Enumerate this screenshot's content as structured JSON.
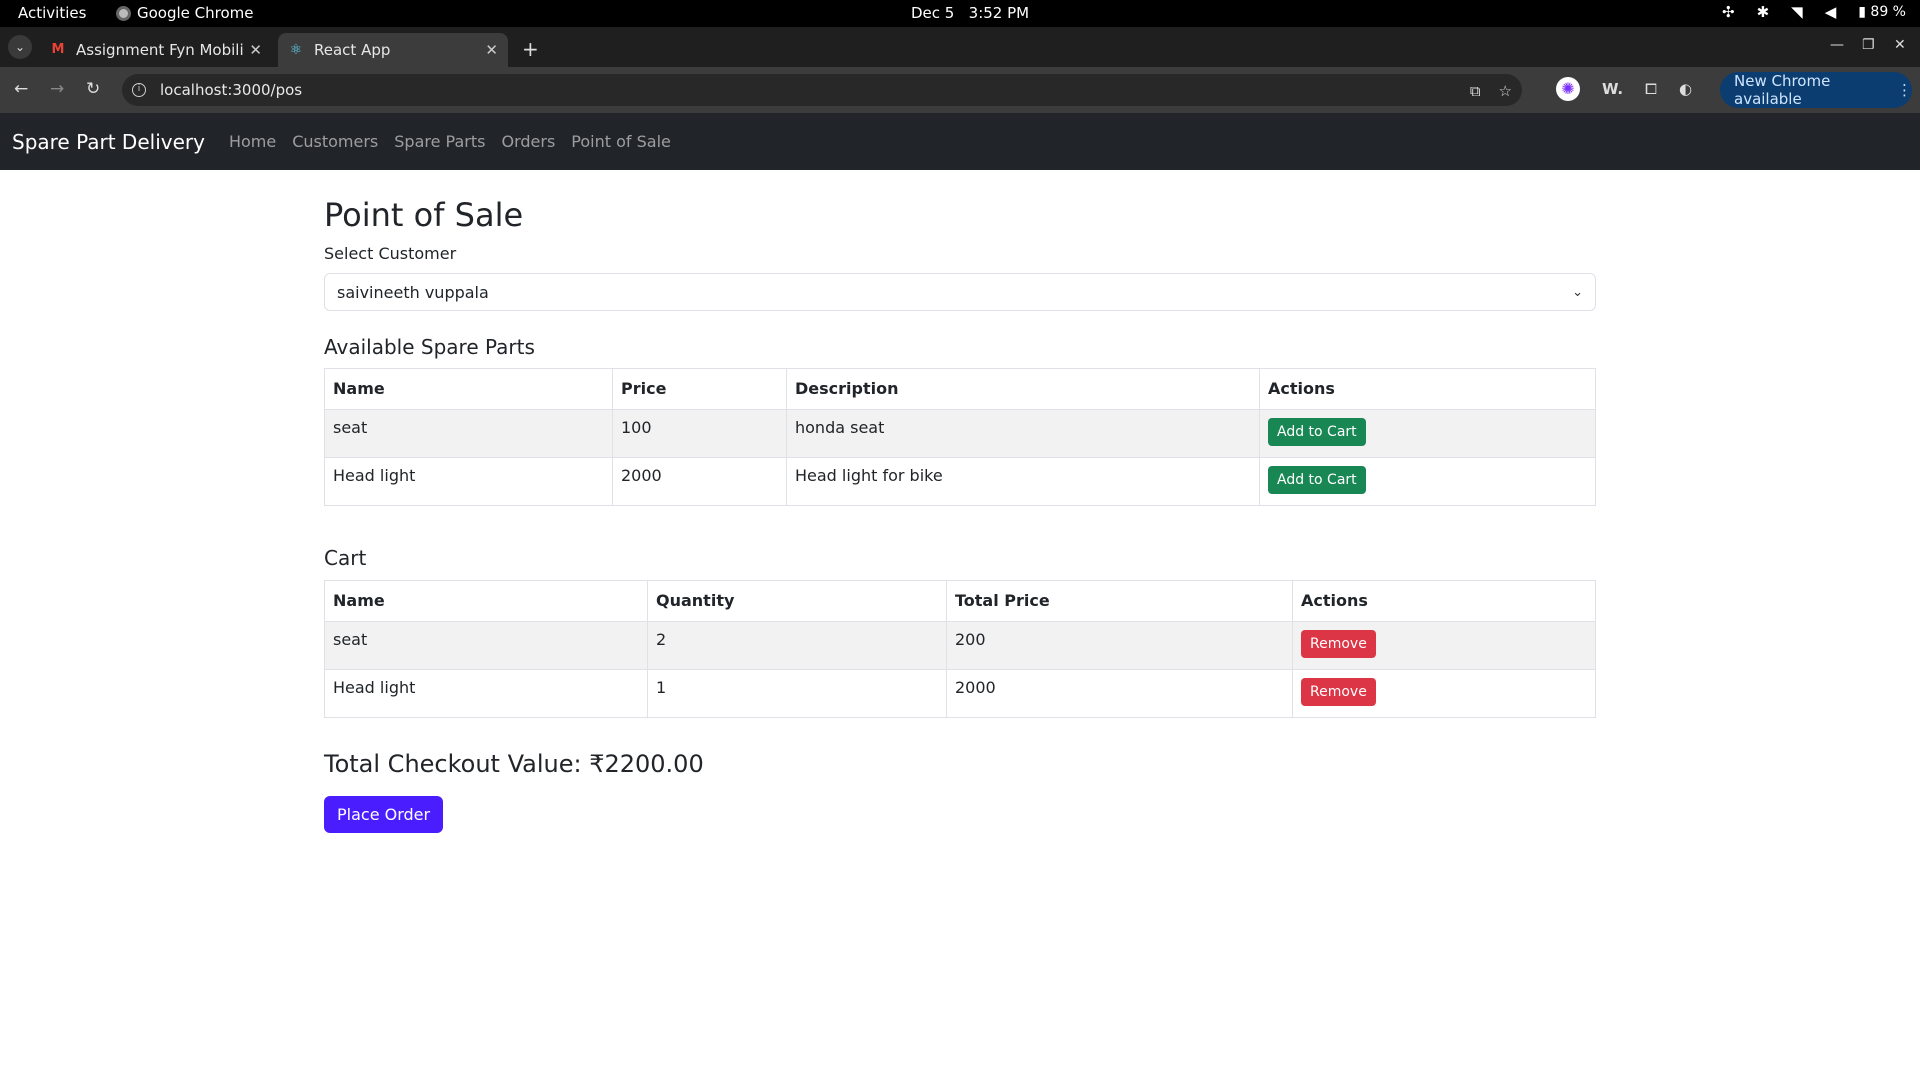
{
  "os_bar": {
    "activities": "Activities",
    "app_name": "Google Chrome",
    "date": "Dec 5",
    "time": "3:52 PM",
    "battery": "89 %"
  },
  "browser": {
    "tabs": [
      {
        "title": "Assignment Fyn Mobility",
        "icon": "gmail-icon",
        "active": false
      },
      {
        "title": "React App",
        "icon": "react-icon",
        "active": true
      }
    ],
    "url": "localhost:3000/pos",
    "ext_label": "W.",
    "update_label": "New Chrome available"
  },
  "navbar": {
    "brand": "Spare Part Delivery",
    "links": [
      "Home",
      "Customers",
      "Spare Parts",
      "Orders",
      "Point of Sale"
    ]
  },
  "page": {
    "title": "Point of Sale",
    "select_label": "Select Customer",
    "selected_customer": "saivineeth vuppala"
  },
  "available": {
    "title": "Available Spare Parts",
    "headers": [
      "Name",
      "Price",
      "Description",
      "Actions"
    ],
    "rows": [
      {
        "name": "seat",
        "price": "100",
        "description": "honda seat",
        "action": "Add to Cart"
      },
      {
        "name": "Head light",
        "price": "2000",
        "description": "Head light for bike",
        "action": "Add to Cart"
      }
    ]
  },
  "cart": {
    "title": "Cart",
    "headers": [
      "Name",
      "Quantity",
      "Total Price",
      "Actions"
    ],
    "rows": [
      {
        "name": "seat",
        "quantity": "2",
        "total": "200",
        "action": "Remove"
      },
      {
        "name": "Head light",
        "quantity": "1",
        "total": "2000",
        "action": "Remove"
      }
    ]
  },
  "checkout": {
    "total_text": "Total Checkout Value: ₹2200.00",
    "place_order": "Place Order"
  },
  "colors": {
    "navbar_bg": "#212529",
    "success": "#198754",
    "danger": "#dc3545",
    "primary": "#4a1dff"
  }
}
